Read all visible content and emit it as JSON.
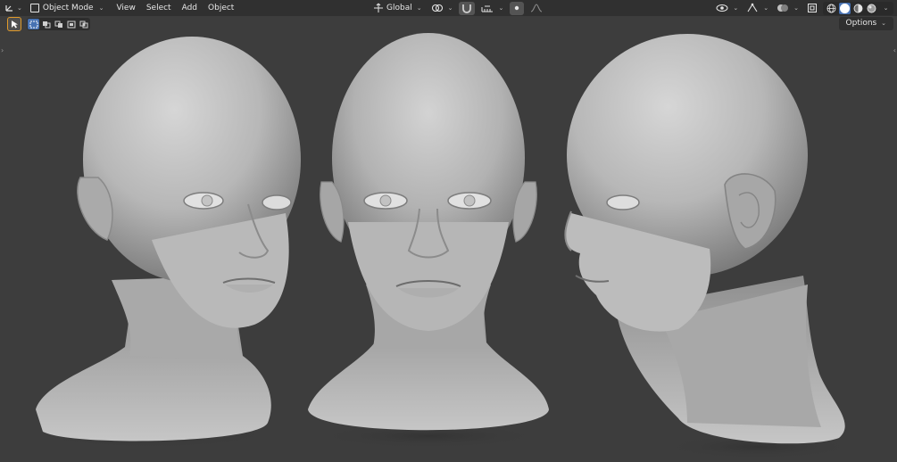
{
  "header": {
    "mode_label": "Object Mode",
    "menus": [
      "View",
      "Select",
      "Add",
      "Object"
    ],
    "orientation_label": "Global"
  },
  "toolbar": {
    "options_label": "Options"
  },
  "colors": {
    "background": "#3d3d3d",
    "header": "#303030",
    "accent": "#4772b3",
    "active_tool_outline": "#e09a2a",
    "skin": "#c8c8c8"
  }
}
